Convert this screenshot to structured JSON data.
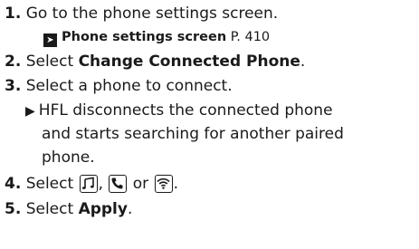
{
  "steps": [
    {
      "num": "1.",
      "text": "Go to the phone settings screen."
    },
    {
      "ref_title": "Phone settings screen",
      "ref_page": "P. 410"
    },
    {
      "num": "2.",
      "pre": "Select ",
      "bold": "Change Connected Phone",
      "post": "."
    },
    {
      "num": "3.",
      "text": "Select a phone to connect."
    },
    {
      "note_lines": [
        "HFL disconnects the connected phone",
        "and starts searching for another paired",
        "phone."
      ]
    },
    {
      "num": "4.",
      "pre": "Select ",
      "sep1": ",",
      "or": " or ",
      "post": "."
    },
    {
      "num": "5.",
      "pre": "Select ",
      "bold": "Apply",
      "post": "."
    }
  ],
  "icons": [
    "music-icon",
    "phone-icon",
    "wifi-icon"
  ]
}
